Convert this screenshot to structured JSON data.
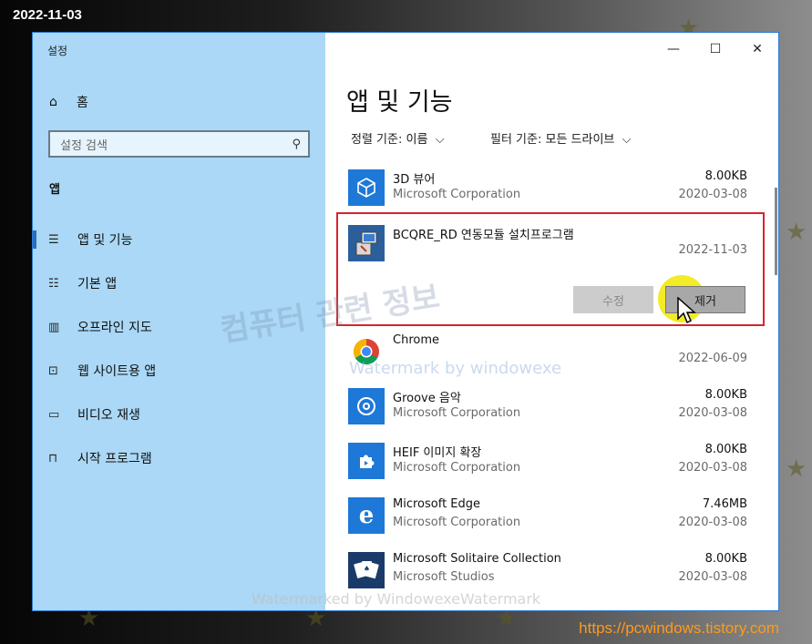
{
  "date_stamp": "2022-11-03",
  "footer_url": "https://pcwindows.tistory.com",
  "window": {
    "title": "설정",
    "controls": {
      "minimize": "—",
      "maximize": "☐",
      "close": "✕"
    }
  },
  "sidebar": {
    "home_label": "홈",
    "search_placeholder": "설정 검색",
    "section": "앱",
    "items": [
      {
        "label": "앱 및 기능",
        "icon": "list-icon",
        "active": true
      },
      {
        "label": "기본 앱",
        "icon": "default-apps-icon"
      },
      {
        "label": "오프라인 지도",
        "icon": "map-icon"
      },
      {
        "label": "웹 사이트용 앱",
        "icon": "web-app-icon"
      },
      {
        "label": "비디오 재생",
        "icon": "video-icon"
      },
      {
        "label": "시작 프로그램",
        "icon": "startup-icon"
      }
    ]
  },
  "main": {
    "title": "앱 및 기능",
    "sort_label": "정렬 기준:",
    "sort_value": "이름",
    "filter_label": "필터 기준:",
    "filter_value": "모든 드라이브",
    "apps": [
      {
        "name": "3D 뷰어",
        "publisher": "Microsoft Corporation",
        "size": "8.00KB",
        "date": "2020-03-08",
        "icon": "cube-icon",
        "color": "#1e78d7"
      },
      {
        "name": "BCQRE_RD 연동모듈 설치프로그램",
        "publisher": "",
        "size": "",
        "date": "2022-11-03",
        "icon": "installer-icon",
        "color": "#2a5f9c",
        "selected": true
      },
      {
        "name": "Chrome",
        "publisher": "",
        "size": "",
        "date": "2022-06-09",
        "icon": "chrome-icon",
        "color": "#ffffff"
      },
      {
        "name": "Groove 음악",
        "publisher": "Microsoft Corporation",
        "size": "8.00KB",
        "date": "2020-03-08",
        "icon": "music-disc-icon",
        "color": "#1e78d7"
      },
      {
        "name": "HEIF 이미지 확장",
        "publisher": "Microsoft Corporation",
        "size": "8.00KB",
        "date": "2020-03-08",
        "icon": "puzzle-icon",
        "color": "#1e78d7"
      },
      {
        "name": "Microsoft Edge",
        "publisher": "Microsoft Corporation",
        "size": "7.46MB",
        "date": "2020-03-08",
        "icon": "edge-icon",
        "color": "#1e78d7"
      },
      {
        "name": "Microsoft Solitaire Collection",
        "publisher": "Microsoft Studios",
        "size": "8.00KB",
        "date": "2020-03-08",
        "icon": "cards-icon",
        "color": "#1a3b6a"
      }
    ],
    "modify_button": "수정",
    "remove_button": "제거"
  },
  "watermarks": {
    "korean": "컴퓨터 관련 정보",
    "english": "Watermark by windowexe",
    "bottom": "Watermarked by WindowexeWatermark"
  },
  "accent_color": "#2a6fc3",
  "highlight_color": "#d9232a"
}
